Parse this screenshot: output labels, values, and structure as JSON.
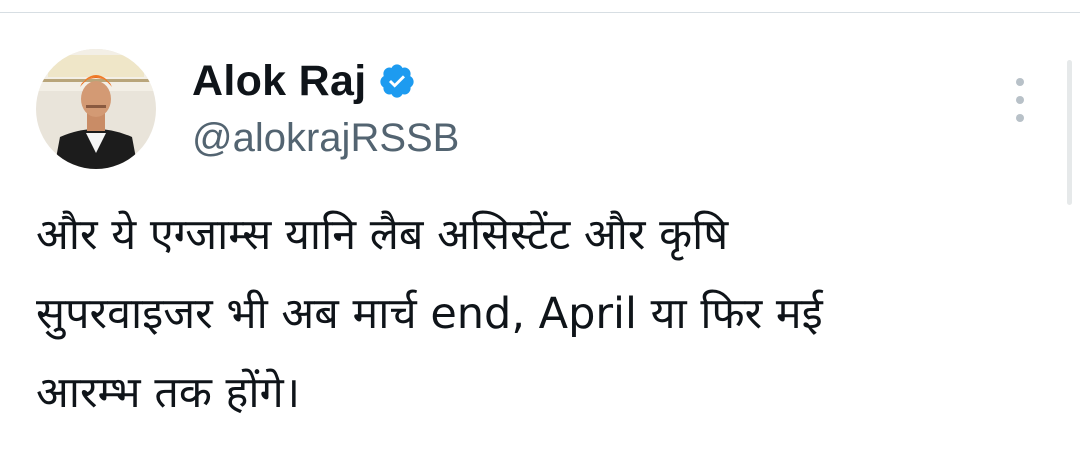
{
  "tweet": {
    "author": {
      "display_name": "Alok Raj",
      "handle": "@alokrajRSSB",
      "verified": true,
      "verified_icon": "verified-badge-icon",
      "avatar_icon": "profile-photo"
    },
    "more_icon": "more-options-icon",
    "text_lines": [
      "और ये एग्जाम्स यानि लैब असिस्टेंट और कृषि",
      "सुपरवाइजर भी अब मार्च end, April या फिर मई",
      "आरम्भ तक होंगे।"
    ]
  },
  "colors": {
    "text": "#0f1419",
    "secondary": "#536471",
    "verified_blue": "#1d9bf0",
    "divider": "#d7dee3"
  }
}
